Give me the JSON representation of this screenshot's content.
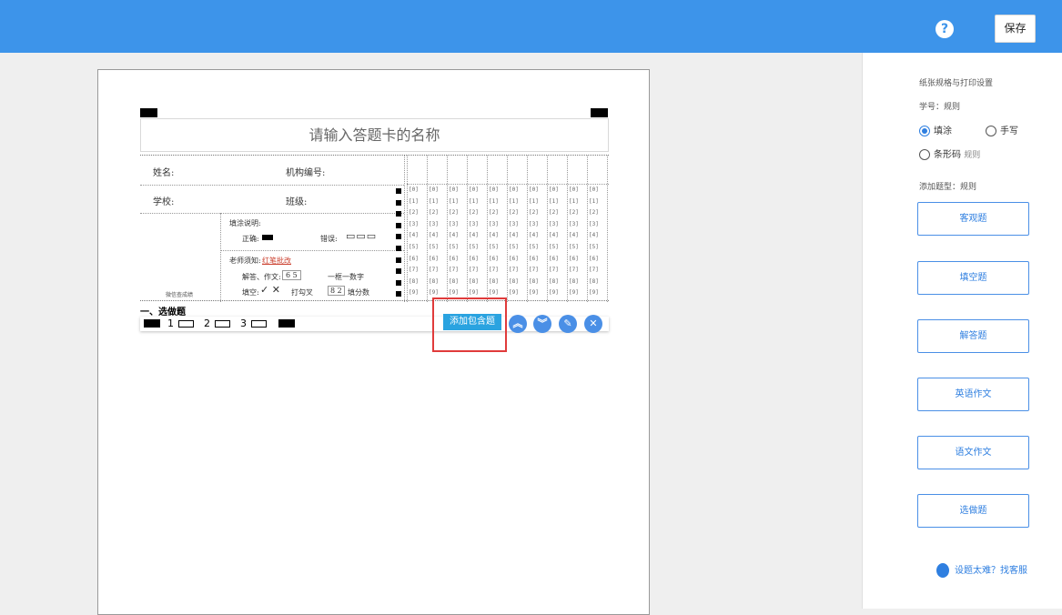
{
  "header": {
    "help_label": "?",
    "save_label": "保存"
  },
  "card": {
    "title_placeholder": "请输入答题卡的名称",
    "name_label": "姓名:",
    "org_label": "机构编号:",
    "school_label": "学校:",
    "class_label": "班级:",
    "fill_guide_label": "填涂说明:",
    "correct_label": "正确:",
    "wrong_label": "错误:",
    "teacher_note_label": "老师须知:",
    "teacher_note_link": "红笔批改",
    "answer_note": "解答、作文:",
    "answer_digits": "6 5",
    "one_digit_label": "一框一数字",
    "fill_blank_label": "填空:",
    "check_label": "打勾叉",
    "score_digits": "8 2",
    "fill_score_label": "填分数",
    "wechat_label": "微信查成绩",
    "digits": [
      "0",
      "1",
      "2",
      "3",
      "4",
      "5",
      "6",
      "7",
      "8",
      "9"
    ]
  },
  "section": {
    "title": "一、选做题",
    "options": [
      "1",
      "2",
      "3"
    ],
    "add_combo_label": "添加包含题",
    "actions": [
      "move-up",
      "move-down",
      "edit",
      "delete"
    ]
  },
  "sidebar": {
    "paper_settings": "纸张规格与打印设置",
    "student_id_label": "学号：规则",
    "radio_fill": "填涂",
    "radio_handwrite": "手写",
    "radio_barcode": "条形码",
    "barcode_rule": "规则",
    "add_type_label": "添加题型：规则",
    "buttons": [
      "客观题",
      "填空题",
      "解答题",
      "英语作文",
      "语文作文",
      "选做题"
    ],
    "support_text": "设题太难？找客服"
  },
  "colors": {
    "topbar": "#3d94ea",
    "accent": "#2f7fe0",
    "highlight": "#e03b3b"
  }
}
